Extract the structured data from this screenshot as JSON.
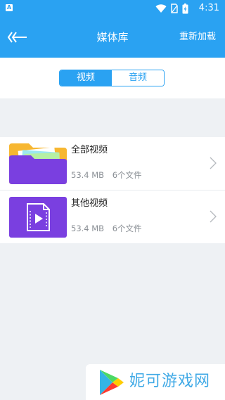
{
  "status_bar": {
    "notification_badge": "A",
    "time": "4:31",
    "icons": [
      "wifi-icon",
      "sim-icon",
      "battery-icon"
    ]
  },
  "app_bar": {
    "back_icon": "back-arrow-icon",
    "title": "媒体库",
    "reload_label": "重新加载"
  },
  "tabs": [
    {
      "label": "视频",
      "active": true
    },
    {
      "label": "音频",
      "active": false
    }
  ],
  "folders": [
    {
      "name": "全部视频",
      "size": "53.4 MB",
      "count": "6个文件",
      "icon": "folder-icon"
    },
    {
      "name": "其他视频",
      "size": "53.4 MB",
      "count": "6个文件",
      "icon": "video-file-icon"
    }
  ],
  "watermark": {
    "text": "妮可游戏网",
    "logo": "play-logo-icon"
  },
  "colors": {
    "accent": "#2aa2f2",
    "purple": "#7a3fe0",
    "background": "#eef1f4",
    "watermark_text": "#3fa9e6"
  }
}
